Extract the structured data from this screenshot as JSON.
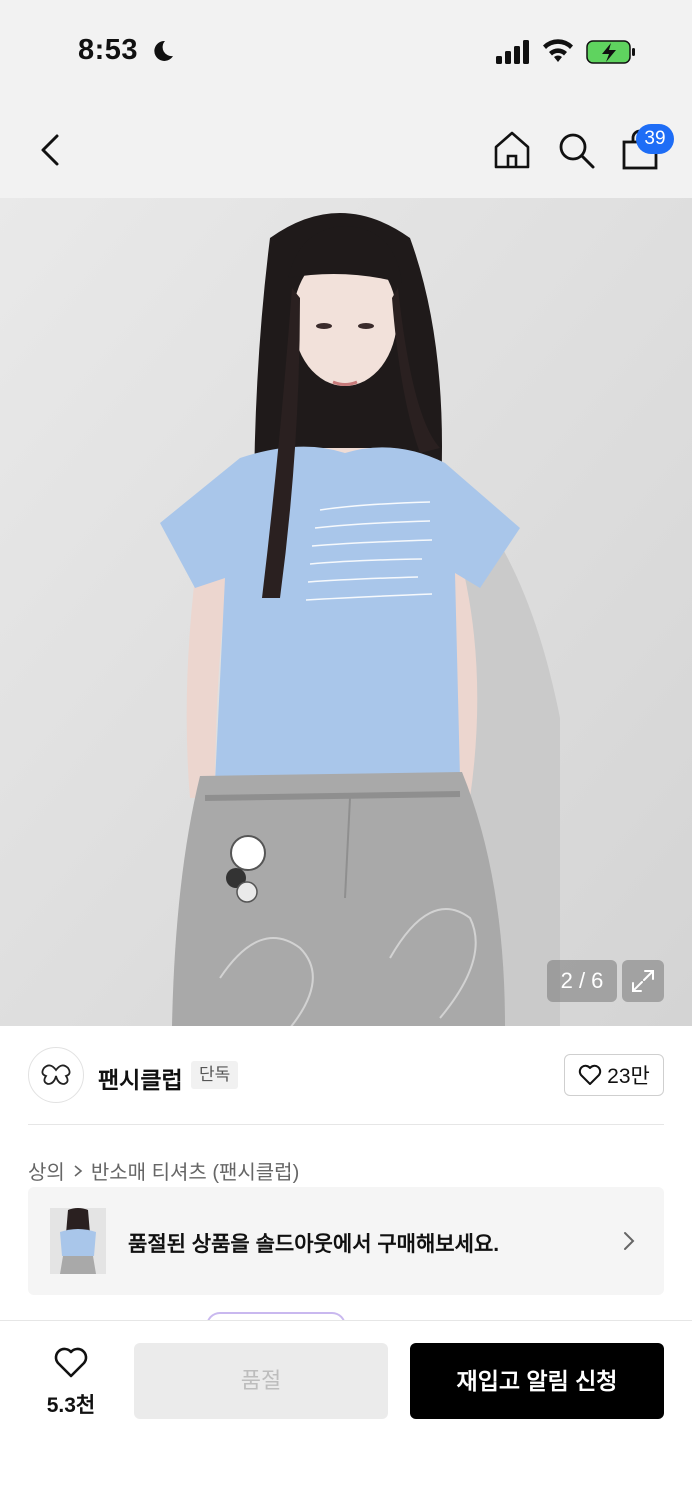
{
  "status_bar": {
    "time": "8:53",
    "icons": [
      "moon-icon",
      "signal-icon",
      "wifi-icon",
      "battery-charging-icon"
    ]
  },
  "header": {
    "icons": [
      "back-arrow-icon",
      "home-icon",
      "search-icon",
      "cart-icon"
    ],
    "cart_badge": "39",
    "badge_color": "#1e6df6"
  },
  "product_image": {
    "counter": "2 / 6",
    "expand_icon": "expand-icon"
  },
  "brand": {
    "name": "팬시클럽",
    "badge": "단독",
    "likes": "23만"
  },
  "breadcrumb": {
    "items": [
      "상의",
      "반소매 티셔츠 (팬시클럽)"
    ]
  },
  "soldout_banner": {
    "text": "품절된 상품을 솔드아웃에서 구매해보세요."
  },
  "bottom_bar": {
    "wish_count": "5.3천",
    "soldout_label": "품절",
    "restock_label": "재입고 알림 신청",
    "primary_color": "#000000"
  }
}
